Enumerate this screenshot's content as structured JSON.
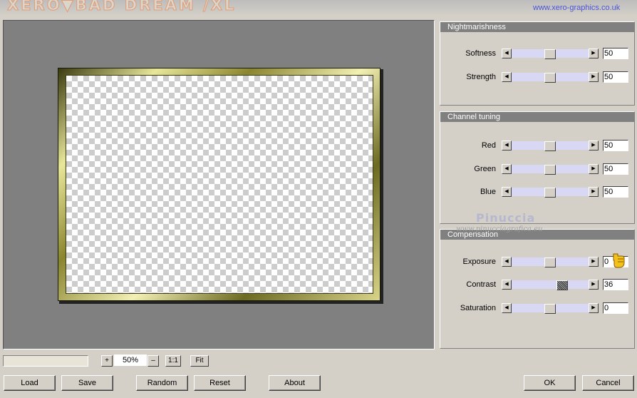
{
  "header": {
    "title": "XERO▼BAD DREAM /XL",
    "website": "www.xero-graphics.co.uk"
  },
  "groups": {
    "nightmarishness": {
      "title": "Nightmarishness",
      "rows": [
        {
          "label": "Softness",
          "value": "50",
          "level": 0.5
        },
        {
          "label": "Strength",
          "value": "50",
          "level": 0.5
        }
      ]
    },
    "channel_tuning": {
      "title": "Channel tuning",
      "rows": [
        {
          "label": "Red",
          "value": "50",
          "level": 0.5
        },
        {
          "label": "Green",
          "value": "50",
          "level": 0.5
        },
        {
          "label": "Blue",
          "value": "50",
          "level": 0.5
        }
      ]
    },
    "compensation": {
      "title": "Compensation",
      "rows": [
        {
          "label": "Exposure",
          "value": "0",
          "level": 0.5
        },
        {
          "label": "Contrast",
          "value": "36",
          "level": 0.68
        },
        {
          "label": "Saturation",
          "value": "0",
          "level": 0.5
        }
      ]
    }
  },
  "watermark": {
    "name": "Pinuccia",
    "site": "www.pinucciagrafica.eu"
  },
  "zoom": {
    "plus": "+",
    "value": "50%",
    "minus": "–",
    "one_to_one": "1:1",
    "fit": "Fit"
  },
  "buttons": {
    "load": "Load",
    "save": "Save",
    "random": "Random",
    "reset": "Reset",
    "about": "About",
    "ok": "OK",
    "cancel": "Cancel"
  },
  "colors": {
    "background": "#d4d0c8",
    "preview_background": "#808080",
    "group_title_bar": "#808080",
    "slider_track": "#d8d8f5",
    "frame_gold": "#e8e79a",
    "website_link": "#4b55d6"
  },
  "icons": [
    "arrow-left-icon",
    "arrow-right-icon",
    "pointing-hand-icon"
  ]
}
